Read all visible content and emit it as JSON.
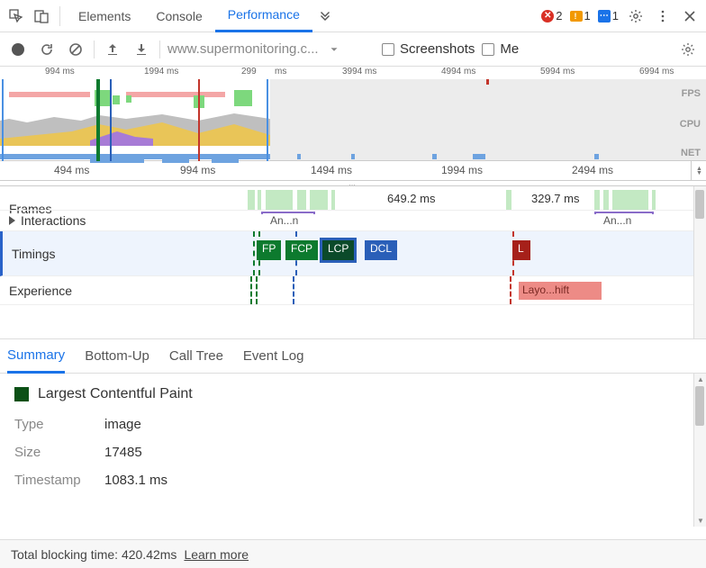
{
  "topbar": {
    "tabs": {
      "elements": "Elements",
      "console": "Console",
      "performance": "Performance"
    },
    "badges": {
      "errors": "2",
      "warnings": "1",
      "info": "1"
    }
  },
  "toolbar2": {
    "url": "www.supermonitoring.c...",
    "screenshots": "Screenshots",
    "memory_trunc": "Me"
  },
  "overview": {
    "ticks": [
      "994 ms",
      "1994 ms",
      "299",
      "ms",
      "3994 ms",
      "4994 ms",
      "5994 ms",
      "6994 ms"
    ],
    "labels": {
      "fps": "FPS",
      "cpu": "CPU",
      "net": "NET"
    }
  },
  "main_ruler": {
    "ticks": [
      "494 ms",
      "994 ms",
      "1494 ms",
      "1994 ms",
      "2494 ms"
    ]
  },
  "tracks": {
    "frames": {
      "label": "Frames",
      "t1": "649.2 ms",
      "t2": "329.7 ms",
      "anim": "An...n",
      "anim2": "An...n"
    },
    "interactions": {
      "label": "Interactions"
    },
    "timings": {
      "label": "Timings",
      "fp": "FP",
      "fcp": "FCP",
      "lcp": "LCP",
      "dcl": "DCL",
      "l": "L"
    },
    "experience": {
      "label": "Experience",
      "layout_shift": "Layo...hift"
    }
  },
  "sumtabs": {
    "summary": "Summary",
    "bottomup": "Bottom-Up",
    "calltree": "Call Tree",
    "eventlog": "Event Log"
  },
  "details": {
    "title": "Largest Contentful Paint",
    "type_k": "Type",
    "type_v": "image",
    "size_k": "Size",
    "size_v": "17485",
    "ts_k": "Timestamp",
    "ts_v": "1083.1 ms"
  },
  "footer": {
    "blocking": "Total blocking time: 420.42ms",
    "learn": "Learn more"
  }
}
